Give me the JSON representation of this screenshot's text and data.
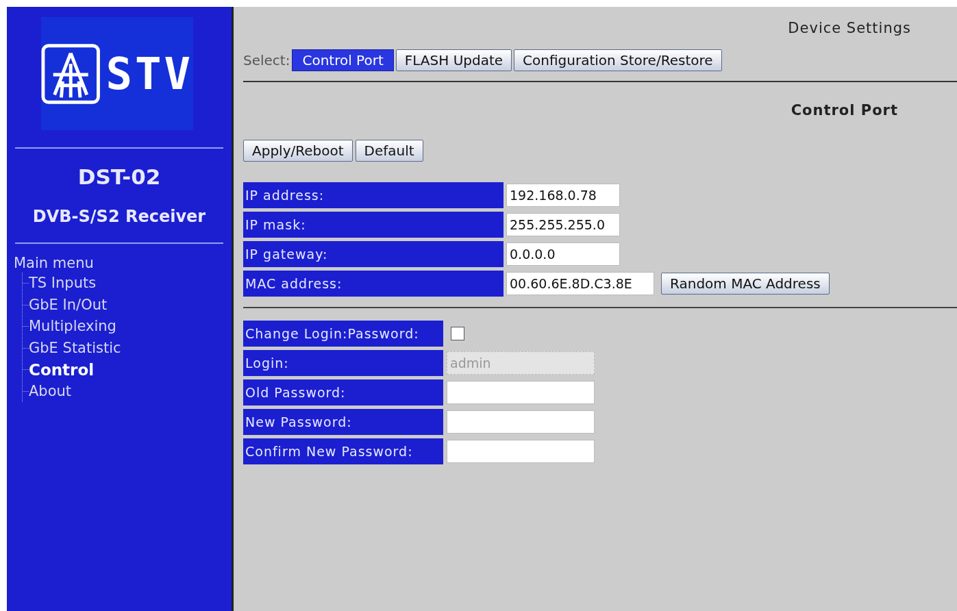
{
  "sidebar": {
    "logo_text": "STV",
    "device": "DST-02",
    "subtitle": "DVB-S/S2 Receiver",
    "menu_title": "Main menu",
    "items": [
      {
        "label": "TS Inputs",
        "selected": false
      },
      {
        "label": "GbE In/Out",
        "selected": false
      },
      {
        "label": "Multiplexing",
        "selected": false
      },
      {
        "label": "GbE Statistic",
        "selected": false
      },
      {
        "label": "Control",
        "selected": true
      },
      {
        "label": "About",
        "selected": false
      }
    ]
  },
  "page_title": "Device Settings",
  "select_label": "Select:",
  "tabs": [
    {
      "label": "Control Port",
      "selected": true
    },
    {
      "label": "FLASH Update",
      "selected": false
    },
    {
      "label": "Configuration Store/Restore",
      "selected": false
    }
  ],
  "section_title": "Control Port",
  "buttons": [
    "Apply/Reboot",
    "Default"
  ],
  "network": [
    {
      "label": "IP address:",
      "value": "192.168.0.78"
    },
    {
      "label": "IP mask:",
      "value": "255.255.255.0"
    },
    {
      "label": "IP gateway:",
      "value": "0.0.0.0"
    },
    {
      "label": "MAC address:",
      "value": "00.60.6E.8D.C3.8E",
      "button": "Random MAC Address"
    }
  ],
  "login": [
    {
      "label": "Change Login:Password:",
      "kind": "checkbox",
      "checked": false
    },
    {
      "label": "Login:",
      "kind": "field",
      "value": "admin",
      "disabled": true
    },
    {
      "label": "Old Password:",
      "kind": "field",
      "disabled": false
    },
    {
      "label": "New Password:",
      "kind": "field",
      "disabled": false
    },
    {
      "label": "Confirm New Password:",
      "kind": "field",
      "disabled": false
    }
  ]
}
